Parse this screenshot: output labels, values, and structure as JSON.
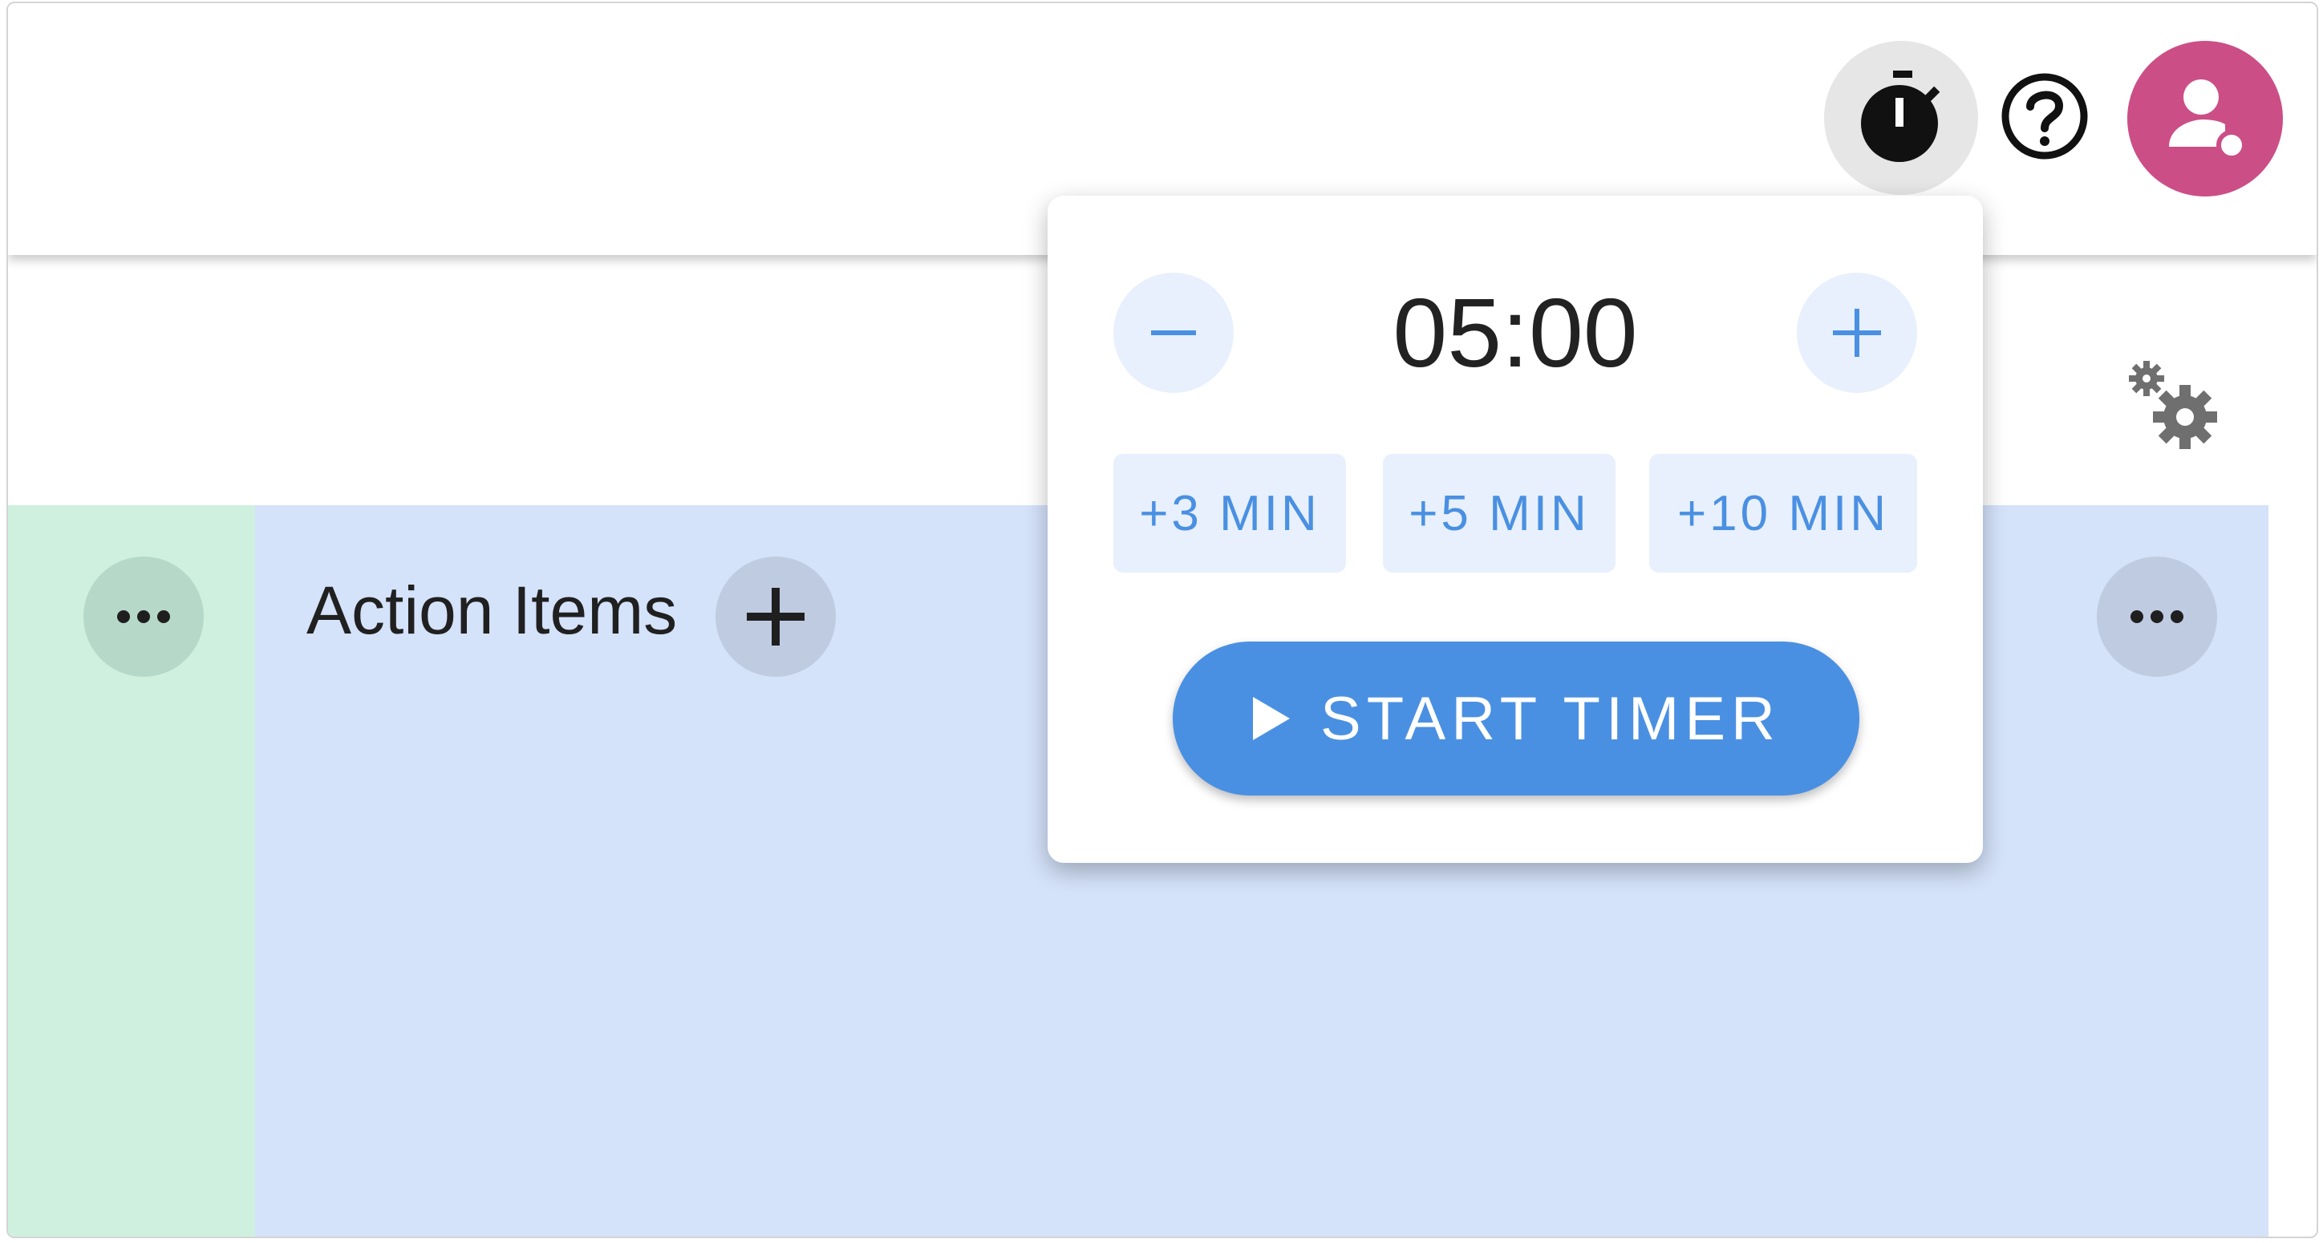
{
  "appbar": {
    "timer_icon": "timer-icon",
    "help_icon": "help-circle-icon",
    "avatar_icon": "person-icon"
  },
  "board": {
    "settings_icon": "gears-icon",
    "columns": [
      {
        "color": "#cff0de",
        "more_icon": "more-horizontal-icon"
      },
      {
        "title": "Action Items",
        "color": "#d4e2fa",
        "add_icon": "plus-icon",
        "more_icon": "more-horizontal-icon"
      }
    ]
  },
  "timer_popover": {
    "time": "05:00",
    "decrement_icon": "minus-icon",
    "increment_icon": "plus-icon",
    "quick_adds": [
      "+3 MIN",
      "+5 MIN",
      "+10 MIN"
    ],
    "start_label": "START TIMER",
    "start_icon": "play-icon"
  },
  "colors": {
    "accent": "#4a90e2",
    "avatar": "#cc4e86",
    "light_accent": "#e7f0fc"
  }
}
